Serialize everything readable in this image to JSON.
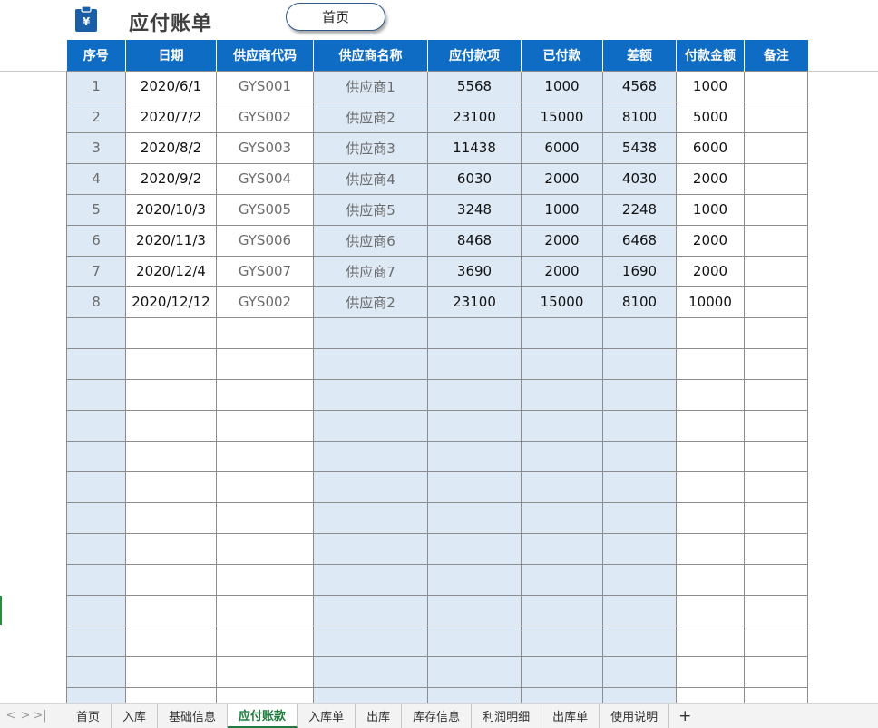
{
  "header": {
    "title": "应付账单",
    "home_button": "首页",
    "icon": "clipboard-yen-icon"
  },
  "table": {
    "columns": [
      "序号",
      "日期",
      "供应商代码",
      "供应商名称",
      "应付款项",
      "已付款",
      "差额",
      "付款金额",
      "备注"
    ],
    "rows": [
      [
        "1",
        "2020/6/1",
        "GYS001",
        "供应商1",
        "5568",
        "1000",
        "4568",
        "1000",
        ""
      ],
      [
        "2",
        "2020/7/2",
        "GYS002",
        "供应商2",
        "23100",
        "15000",
        "8100",
        "5000",
        ""
      ],
      [
        "3",
        "2020/8/2",
        "GYS003",
        "供应商3",
        "11438",
        "6000",
        "5438",
        "6000",
        ""
      ],
      [
        "4",
        "2020/9/2",
        "GYS004",
        "供应商4",
        "6030",
        "2000",
        "4030",
        "2000",
        ""
      ],
      [
        "5",
        "2020/10/3",
        "GYS005",
        "供应商5",
        "3248",
        "1000",
        "2248",
        "1000",
        ""
      ],
      [
        "6",
        "2020/11/3",
        "GYS006",
        "供应商6",
        "8468",
        "2000",
        "6468",
        "2000",
        ""
      ],
      [
        "7",
        "2020/12/4",
        "GYS007",
        "供应商7",
        "3690",
        "2000",
        "1690",
        "2000",
        ""
      ],
      [
        "8",
        "2020/12/12",
        "GYS002",
        "供应商2",
        "23100",
        "15000",
        "8100",
        "10000",
        ""
      ]
    ],
    "header_color": "#0f6cc4",
    "shade_color": "#dde9f5"
  },
  "sheet_tabs": {
    "items": [
      "首页",
      "入库",
      "基础信息",
      "应付账款",
      "入库单",
      "出库",
      "库存信息",
      "利润明细",
      "出库单",
      "使用说明"
    ],
    "active": "应付账款",
    "add_label": "+",
    "nav": [
      "<",
      ">",
      ">|"
    ],
    "active_color": "#1e7c3c"
  }
}
